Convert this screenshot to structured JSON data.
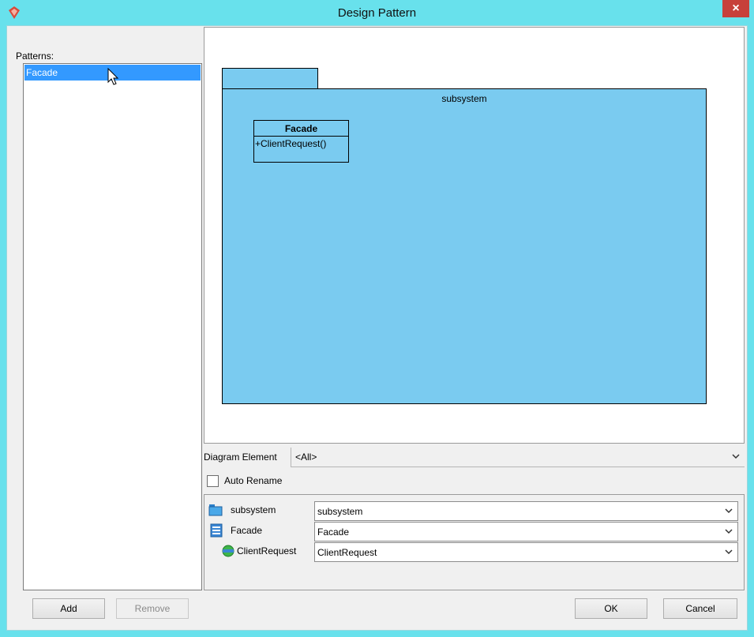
{
  "window": {
    "title": "Design Pattern",
    "close_label": "×"
  },
  "patterns": {
    "label": "Patterns:",
    "items": [
      "Facade"
    ]
  },
  "diagram": {
    "package_name": "subsystem",
    "class_name": "Facade",
    "class_operation": "+ClientRequest()"
  },
  "diagram_element": {
    "label": "Diagram Element",
    "value": "<All>"
  },
  "auto_rename": {
    "label": "Auto Rename",
    "checked": false
  },
  "mapping": [
    {
      "name": "subsystem",
      "value": "subsystem",
      "icon": "package-icon"
    },
    {
      "name": "Facade",
      "value": "Facade",
      "icon": "class-icon"
    },
    {
      "name": "ClientRequest",
      "value": "ClientRequest",
      "icon": "operation-icon"
    }
  ],
  "buttons": {
    "add": "Add",
    "remove": "Remove",
    "ok": "OK",
    "cancel": "Cancel"
  },
  "colors": {
    "titlebar": "#68e1ec",
    "selection": "#3399ff",
    "package_fill": "#7acbf0",
    "close": "#c7403a"
  }
}
